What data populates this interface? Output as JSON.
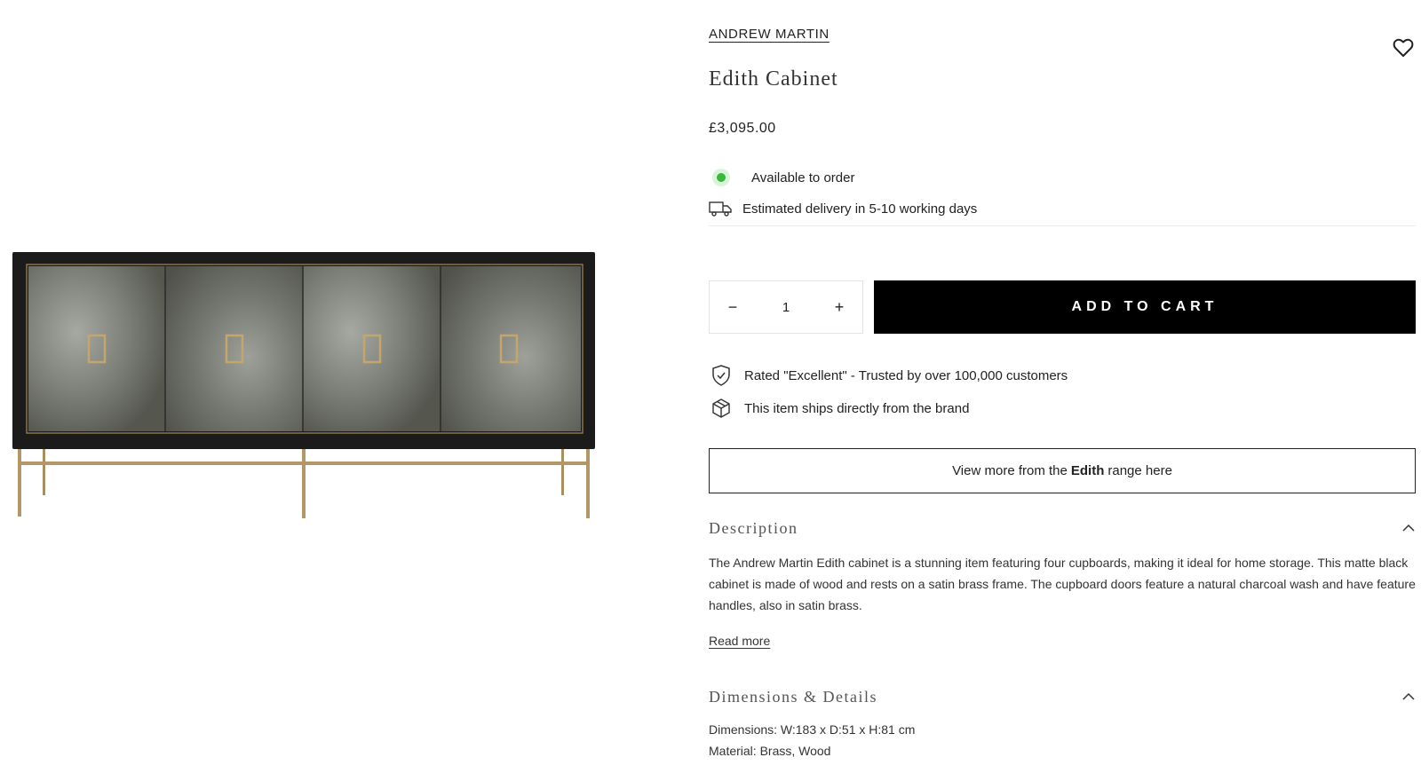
{
  "product": {
    "brand": "ANDREW MARTIN",
    "title": "Edith Cabinet",
    "price": "£3,095.00",
    "stock_status": "Available to order",
    "delivery": "Estimated delivery in 5-10 working days"
  },
  "cart": {
    "quantity": "1",
    "minus_label": "−",
    "plus_label": "+",
    "add_to_cart_label": "ADD TO CART"
  },
  "trust": {
    "rated": "Rated \"Excellent\" - Trusted by over 100,000 customers",
    "ships": "This item ships directly from the brand"
  },
  "range_button": {
    "prefix": "View more from the",
    "range_name": "Edith",
    "suffix": "range here"
  },
  "description": {
    "heading": "Description",
    "text": "The Andrew Martin Edith cabinet is a stunning item featuring four cupboards, making it ideal for home storage. This matte black cabinet is made of wood and rests on a satin brass frame. The cupboard doors feature a natural charcoal wash and have feature handles, also in satin brass.",
    "read_more": "Read more"
  },
  "dimensions": {
    "heading": "Dimensions & Details",
    "dimensions": "Dimensions: W:183 x D:51 x H:81 cm",
    "material": "Material: Brass, Wood"
  },
  "icons": {
    "wishlist": "heart-icon",
    "stock": "status-dot-icon",
    "delivery": "truck-icon",
    "rated": "shield-check-icon",
    "ships": "box-icon",
    "accordion": "chevron-up-icon"
  },
  "colors": {
    "accent": "#000000",
    "stock_dot": "#38b93a",
    "cabinet_frame": "#1b1b1b",
    "door_wash": "#7a7d76",
    "brass": "#b39766"
  }
}
